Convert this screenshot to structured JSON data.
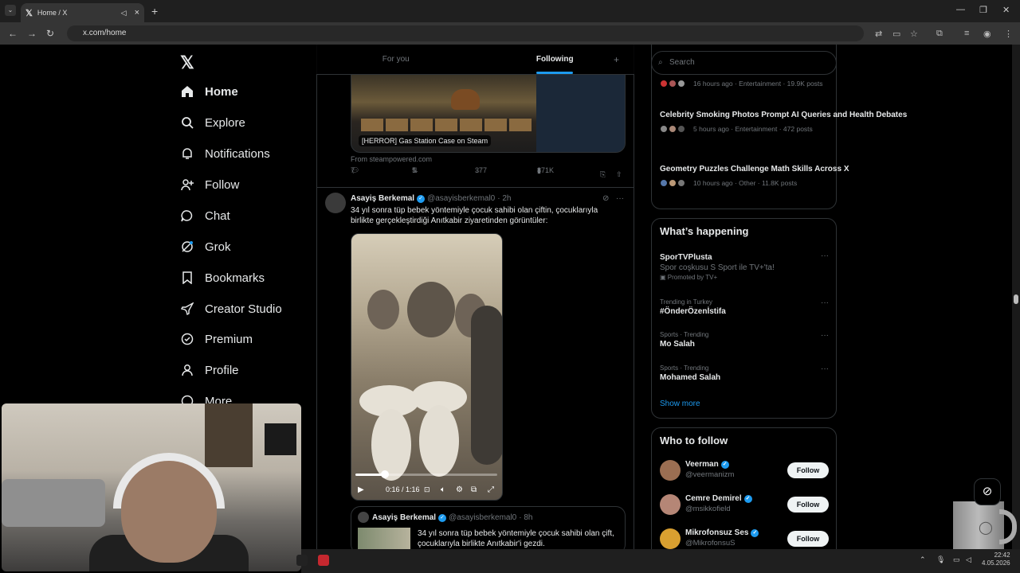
{
  "browser": {
    "tab_title": "Home / X",
    "url": "x.com/home",
    "new_tab": "+"
  },
  "sidebar": {
    "logo": "𝕏",
    "items": [
      {
        "label": "Home",
        "icon": "home-icon"
      },
      {
        "label": "Explore",
        "icon": "search-icon"
      },
      {
        "label": "Notifications",
        "icon": "bell-icon"
      },
      {
        "label": "Follow",
        "icon": "person-add-icon"
      },
      {
        "label": "Chat",
        "icon": "chat-icon"
      },
      {
        "label": "Grok",
        "icon": "grok-icon"
      },
      {
        "label": "Bookmarks",
        "icon": "bookmark-icon"
      },
      {
        "label": "Creator Studio",
        "icon": "rocket-icon"
      },
      {
        "label": "Premium",
        "icon": "badge-icon"
      },
      {
        "label": "Profile",
        "icon": "person-icon"
      },
      {
        "label": "More",
        "icon": "more-icon"
      }
    ]
  },
  "timeline": {
    "tabs": [
      "For you",
      "Following"
    ],
    "active_tab": "Following",
    "card": {
      "caption": "[HERROR] Gas Station Case on Steam",
      "source": "From steampowered.com"
    },
    "actions": {
      "replies": "7",
      "reposts": "5",
      "likes": "377",
      "views": "871K"
    },
    "post": {
      "name": "Asayiş Berkemal",
      "handle": "@asayisberkemal0",
      "time": "· 2h",
      "text": "34 yıl sonra tüp bebek yöntemiyle çocuk sahibi olan çiftin, çocuklarıyla birlikte gerçekleştirdiği Anıtkabir ziyaretinden görüntüler:",
      "video_time": "0:16 / 1:16",
      "video_progress": 0.21
    },
    "quote": {
      "name": "Asayiş Berkemal",
      "handle": "@asayisberkemal0",
      "time": "· 8h",
      "text": "34 yıl sonra tüp bebek yöntemiyle çocuk sahibi olan çift, çocuklarıyla birlikte Anıtkabir'i gezdi."
    }
  },
  "right": {
    "search_placeholder": "Search",
    "trends_top": [
      {
        "title": "",
        "meta": "16 hours ago · Entertainment · 19.9K posts"
      },
      {
        "title": "Celebrity Smoking Photos Prompt AI Queries and Health Debates",
        "meta": "5 hours ago · Entertainment · 472 posts"
      },
      {
        "title": "Geometry Puzzles Challenge Math Skills Across X",
        "meta": "10 hours ago · Other · 11.8K posts"
      }
    ],
    "happening_title": "What’s happening",
    "happening": [
      {
        "sub": "",
        "title": "SporTVPlusta",
        "desc": "Spor coşkusu S Sport ile TV+'ta!",
        "promo": "Promoted by TV+"
      },
      {
        "sub": "Trending in Turkey",
        "title": "#ÖnderÖzenİstifa"
      },
      {
        "sub": "Sports · Trending",
        "title": "Mo Salah"
      },
      {
        "sub": "Sports · Trending",
        "title": "Mohamed Salah"
      }
    ],
    "show_more": "Show more",
    "wtf_title": "Who to follow",
    "wtf": [
      {
        "name": "Veerman",
        "handle": "@veermanizm",
        "button": "Follow"
      },
      {
        "name": "Cemre Demirel",
        "handle": "@msikkofield",
        "button": "Follow"
      },
      {
        "name": "Mikrofonsuz Ses",
        "handle": "@MikrofonsuS",
        "button": "Follow"
      }
    ]
  },
  "system": {
    "clock_time": "22:42",
    "clock_date": "4.05.2026"
  },
  "colors": {
    "accent": "#1d9bf0",
    "bg": "#000000",
    "border": "#2f3336"
  }
}
